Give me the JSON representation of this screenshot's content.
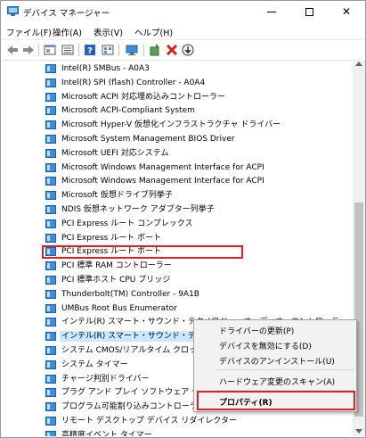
{
  "window": {
    "title": "デバイス マネージャー",
    "minimize_glyph": "",
    "close_glyph": "✕"
  },
  "menu": [
    "ファイル(F)",
    "操作(A)",
    "表示(V)",
    "ヘルプ(H)"
  ],
  "toolbar": {
    "icons": [
      "back-arrow-icon",
      "forward-arrow-icon",
      "properties-pane-icon",
      "device-list-icon",
      "help-icon",
      "view-icon",
      "monitor-icon",
      "add-driver-icon",
      "uninstall-icon",
      "download-icon"
    ]
  },
  "tree": {
    "items": [
      "Intel(R) SMBus - A0A3",
      "Intel(R) SPI (flash) Controller - A0A4",
      "Microsoft ACPI 対応埋め込みコントローラー",
      "Microsoft ACPI-Compliant System",
      "Microsoft Hyper-V 仮想化インフラストラクチャ ドライバー",
      "Microsoft System Management BIOS Driver",
      "Microsoft UEFI 対応システム",
      "Microsoft Windows Management Interface for ACPI",
      "Microsoft Windows Management Interface for ACPI",
      "Microsoft 仮想ドライブ列挙子",
      "NDIS 仮想ネットワーク アダプター列挙子",
      "PCI Express ルート コンプレックス",
      "PCI Express ルート ポート",
      "PCI Express ルート ポート",
      "PCI 標準 RAM コントローラー",
      "PCI 標準ホスト CPU ブリッジ",
      "Thunderbolt(TM) Controller - 9A1B",
      "UMBus Root Bus Enumerator",
      "インテル(R) スマート・サウンド・テクノロジー・オーディオ・コントローラー",
      "インテル(R) スマート・サウンド・テクノロジー OED",
      "システム CMOS/リアルタイム クロック",
      "システム タイマー",
      "チャージ判別ドライバー",
      "プラグ アンド プレイ ソフトウェア デバイス列",
      "プログラム可能割り込みコントローラー",
      "リモート デスクトップ デバイス リダイレクター",
      "高精度イベント タイマー",
      "複合バス列挙子"
    ],
    "selected_index": 19,
    "selection_color": "#cce8ff",
    "highlight_color": "#e02020"
  },
  "context_menu": {
    "items": {
      "update_driver": "ドライバーの更新(P)",
      "disable_device": "デバイスを無効にする(D)",
      "uninstall_device": "デバイスのアンインストール(U)",
      "scan_hardware": "ハードウェア変更のスキャン(A)",
      "properties": "プロパティ(R)"
    }
  }
}
